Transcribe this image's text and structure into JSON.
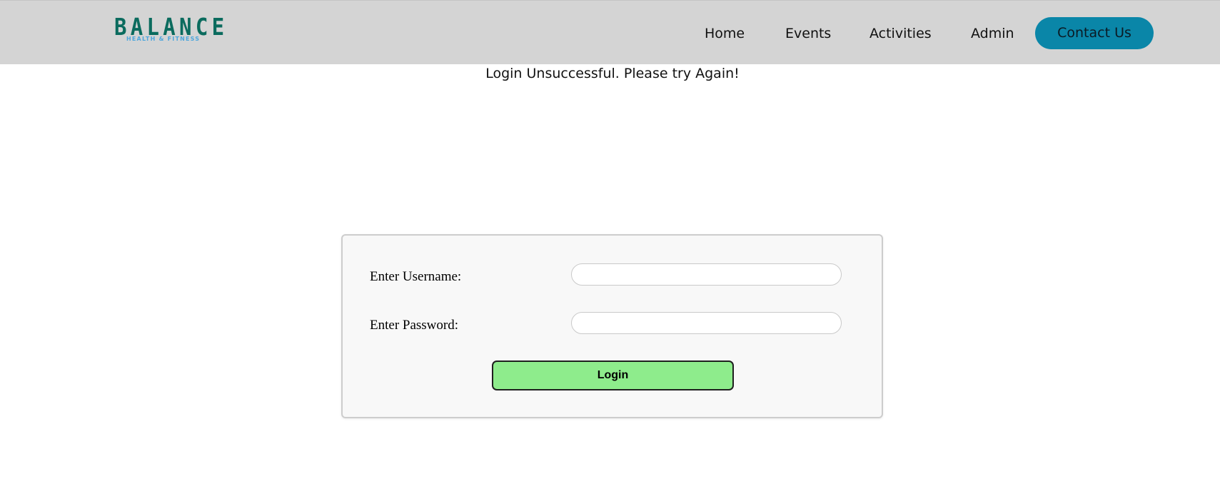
{
  "brand": {
    "logo_main": "BALANCE",
    "logo_sub": "HEALTH & FITNESS"
  },
  "nav": {
    "items": [
      {
        "label": "Home"
      },
      {
        "label": "Events"
      },
      {
        "label": "Activities"
      },
      {
        "label": "Admin"
      }
    ],
    "contact_label": "Contact Us"
  },
  "status": {
    "message": "Login Unsuccessful. Please try Again!"
  },
  "login_form": {
    "username_label": "Enter Username:",
    "username_value": "",
    "password_label": "Enter Password:",
    "password_value": "",
    "submit_label": "Login"
  },
  "colors": {
    "header_bg": "#d4d4d4",
    "logo_main": "#0b6b5e",
    "logo_sub": "#4fa7dc",
    "contact_button": "#0a86a8",
    "login_button": "#8eec8c",
    "card_bg": "#f8f8f8"
  }
}
